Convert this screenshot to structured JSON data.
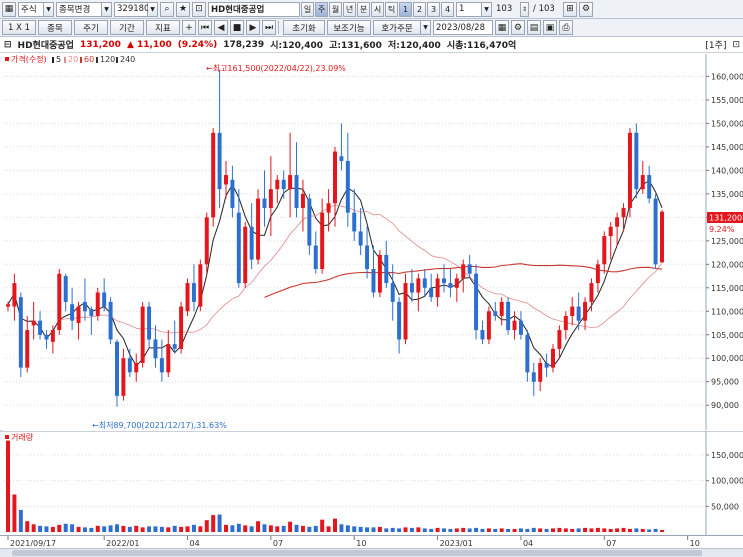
{
  "toolbar": {
    "market": "주식",
    "change_code": "종목변경",
    "code": "329180",
    "name": "HD현대중공업",
    "periods": [
      "일",
      "주",
      "월",
      "년",
      "분",
      "시",
      "틱"
    ],
    "selected_period": "주",
    "period_nums": [
      "1",
      "2",
      "3",
      "4"
    ],
    "selected_num": "1",
    "unit": "1",
    "count": "103",
    "total": "/ 103"
  },
  "toolbar2": {
    "ratio": "1 X 1",
    "add_item": "종목",
    "period_btn": "주기",
    "term_btn": "기간",
    "indicator_btn": "지표",
    "init_btn": "초기화",
    "aux_btn": "보조기능",
    "order_btn": "호가주문",
    "date": "2023/08/28"
  },
  "info": {
    "name": "HD현대중공업",
    "price": "131,200",
    "change": "▲ 11,100",
    "change_pct": "(9.24%)",
    "volume": "178,239",
    "open": "시:120,400",
    "high": "고:131,600",
    "low": "저:120,400",
    "market_cap": "시총:116,470억",
    "unit_label": "[1주]"
  },
  "price_legend": {
    "price": "가격(수정)",
    "ma": [
      "5",
      "20",
      "60",
      "120",
      "240"
    ]
  },
  "annotations": {
    "high": "최고161,500(2022/04/22),23.09%",
    "low": "최저89,700(2021/12/17),31.63%"
  },
  "volume_legend": "거래량",
  "current_price_tag": "131,200",
  "current_pct_tag": "9.24%",
  "colors": {
    "up": "#e2161c",
    "down": "#2d6fce",
    "ma5": "#222222",
    "ma20": "#e28a8a",
    "ma60": "#c9362f"
  },
  "chart_data": [
    {
      "type": "candlestick",
      "title": "",
      "period": "weekly",
      "date_ticks": [
        "2021/09/17",
        "2022/01",
        "04",
        "07",
        "10",
        "2023/01",
        "04",
        "07",
        "10"
      ],
      "y_ticks": [
        "90,000",
        "95,000",
        "100,000",
        "105,000",
        "110,000",
        "115,000",
        "120,000",
        "125,000",
        "130,000",
        "135,000",
        "140,000",
        "145,000",
        "150,000",
        "155,000",
        "160,000"
      ],
      "ylim": [
        86000,
        163500
      ],
      "ohlc": [
        [
          111000,
          112000,
          110000,
          111500
        ],
        [
          111000,
          118000,
          108000,
          116000
        ],
        [
          113000,
          114000,
          96000,
          98000
        ],
        [
          98000,
          109000,
          97000,
          106000
        ],
        [
          107000,
          112000,
          104000,
          108000
        ],
        [
          108000,
          110000,
          104000,
          105000
        ],
        [
          105000,
          106000,
          102000,
          104000
        ],
        [
          103500,
          107000,
          101000,
          106000
        ],
        [
          106000,
          119000,
          105000,
          118000
        ],
        [
          117500,
          118000,
          110000,
          112000
        ],
        [
          111500,
          115000,
          106000,
          108000
        ],
        [
          107500,
          112000,
          104000,
          111000
        ],
        [
          112000,
          117000,
          108000,
          110000
        ],
        [
          110500,
          111000,
          105000,
          109000
        ],
        [
          109000,
          115000,
          108000,
          114000
        ],
        [
          114000,
          117000,
          110000,
          111000
        ],
        [
          112000,
          113000,
          103000,
          104000
        ],
        [
          103500,
          104000,
          89700,
          92000
        ],
        [
          92000,
          102000,
          91000,
          100000
        ],
        [
          100000,
          102000,
          96000,
          97000
        ],
        [
          97000,
          101000,
          95000,
          99000
        ],
        [
          99000,
          112000,
          98000,
          111000
        ],
        [
          111000,
          112000,
          102000,
          104000
        ],
        [
          104000,
          107000,
          98000,
          100000
        ],
        [
          100000,
          104000,
          95000,
          97000
        ],
        [
          97000,
          106000,
          96000,
          103000
        ],
        [
          103000,
          108000,
          101000,
          102000
        ],
        [
          102000,
          112000,
          101000,
          111000
        ],
        [
          110000,
          117000,
          109000,
          116000
        ],
        [
          116000,
          120000,
          110000,
          112000
        ],
        [
          111000,
          121000,
          110000,
          120000
        ],
        [
          120000,
          131000,
          118000,
          130000
        ],
        [
          130000,
          149000,
          128000,
          148000
        ],
        [
          148000,
          161500,
          132000,
          136000
        ],
        [
          137000,
          142000,
          134000,
          139000
        ],
        [
          138000,
          141000,
          130000,
          132000
        ],
        [
          131000,
          136000,
          115000,
          116000
        ],
        [
          116000,
          129000,
          115000,
          128000
        ],
        [
          128000,
          133000,
          119000,
          121000
        ],
        [
          121000,
          136000,
          120000,
          134000
        ],
        [
          134000,
          140000,
          128000,
          132000
        ],
        [
          132000,
          143000,
          126000,
          136000
        ],
        [
          136000,
          139000,
          133000,
          138000
        ],
        [
          138000,
          140000,
          134000,
          136000
        ],
        [
          136000,
          148000,
          130000,
          139000
        ],
        [
          139000,
          146000,
          130000,
          132000
        ],
        [
          132000,
          138000,
          127000,
          135000
        ],
        [
          134000,
          135000,
          122000,
          124000
        ],
        [
          124000,
          127000,
          118000,
          119000
        ],
        [
          119000,
          134000,
          118000,
          131000
        ],
        [
          131000,
          136000,
          127000,
          133000
        ],
        [
          133000,
          145000,
          128000,
          144000
        ],
        [
          143000,
          150000,
          140000,
          142000
        ],
        [
          142000,
          148000,
          128000,
          131000
        ],
        [
          131000,
          136000,
          125000,
          127000
        ],
        [
          127000,
          132000,
          122000,
          124000
        ],
        [
          124000,
          128000,
          117000,
          119000
        ],
        [
          119000,
          124000,
          113000,
          114000
        ],
        [
          114000,
          123000,
          113000,
          122000
        ],
        [
          122000,
          125000,
          115000,
          116000
        ],
        [
          116000,
          120000,
          108000,
          112000
        ],
        [
          112000,
          113000,
          101000,
          104000
        ],
        [
          104000,
          118000,
          103000,
          116000
        ],
        [
          116000,
          119000,
          112000,
          114000
        ],
        [
          114000,
          118000,
          110000,
          117000
        ],
        [
          117000,
          119000,
          113000,
          115000
        ],
        [
          115000,
          118000,
          112000,
          113000
        ],
        [
          113000,
          118000,
          111000,
          117000
        ],
        [
          117000,
          120000,
          114000,
          116000
        ],
        [
          116000,
          119000,
          113000,
          115000
        ],
        [
          115000,
          118000,
          112000,
          117000
        ],
        [
          117000,
          121000,
          114000,
          120000
        ],
        [
          120000,
          122000,
          117000,
          118000
        ],
        [
          118000,
          120000,
          104000,
          106000
        ],
        [
          106000,
          108000,
          103000,
          104000
        ],
        [
          104000,
          111000,
          103000,
          110000
        ],
        [
          110000,
          112000,
          108000,
          109000
        ],
        [
          109000,
          113000,
          107000,
          112000
        ],
        [
          112000,
          113000,
          105000,
          106000
        ],
        [
          106000,
          110000,
          104000,
          108000
        ],
        [
          108000,
          110000,
          104000,
          105000
        ],
        [
          105000,
          106000,
          95000,
          97000
        ],
        [
          97000,
          99000,
          92000,
          95000
        ],
        [
          95000,
          100000,
          93000,
          99000
        ],
        [
          99000,
          101000,
          96000,
          98000
        ],
        [
          98000,
          103000,
          97000,
          102000
        ],
        [
          102000,
          107000,
          100000,
          106000
        ],
        [
          106000,
          110000,
          104000,
          109000
        ],
        [
          109000,
          113000,
          107000,
          111000
        ],
        [
          111000,
          114000,
          106000,
          108000
        ],
        [
          108000,
          113000,
          106000,
          112000
        ],
        [
          112000,
          117000,
          110000,
          116000
        ],
        [
          116000,
          121000,
          114000,
          120000
        ],
        [
          120000,
          127000,
          118000,
          126000
        ],
        [
          126000,
          129000,
          121000,
          128000
        ],
        [
          128000,
          131000,
          124000,
          130000
        ],
        [
          130000,
          133000,
          127000,
          132000
        ],
        [
          132000,
          149000,
          130000,
          148000
        ],
        [
          148000,
          150000,
          134000,
          136000
        ],
        [
          136000,
          142000,
          135000,
          139000
        ],
        [
          139000,
          141000,
          133000,
          134000
        ],
        [
          134000,
          135000,
          119000,
          120000
        ],
        [
          120400,
          131600,
          120400,
          131200
        ]
      ]
    },
    {
      "type": "bar",
      "title": "거래량",
      "y_ticks": [
        "50,000",
        "100,000",
        "150,000"
      ],
      "ylim": [
        0,
        185000
      ],
      "values": [
        178000,
        73000,
        43000,
        21000,
        15000,
        12000,
        11000,
        10000,
        14000,
        16000,
        15000,
        10000,
        9000,
        8000,
        12000,
        11000,
        13000,
        15000,
        12000,
        10000,
        12000,
        9000,
        11000,
        11000,
        10000,
        9000,
        12000,
        10000,
        11000,
        14000,
        11000,
        23000,
        33000,
        34000,
        14000,
        13000,
        16000,
        13000,
        11000,
        21000,
        15000,
        13000,
        11000,
        12000,
        20000,
        14000,
        12000,
        10000,
        12000,
        24000,
        11000,
        26000,
        15000,
        13000,
        11000,
        10000,
        9000,
        9000,
        10000,
        7000,
        8000,
        7000,
        9000,
        8000,
        9000,
        7000,
        6000,
        8000,
        7000,
        6000,
        7000,
        8000,
        7000,
        8000,
        6000,
        7000,
        6000,
        7000,
        6000,
        6000,
        7000,
        6000,
        8000,
        7000,
        6000,
        7000,
        8000,
        7000,
        6000,
        7000,
        8000,
        7000,
        8000,
        7000,
        6000,
        7000,
        8000,
        6000,
        7000,
        6000,
        5000,
        6000,
        4000
      ]
    }
  ]
}
